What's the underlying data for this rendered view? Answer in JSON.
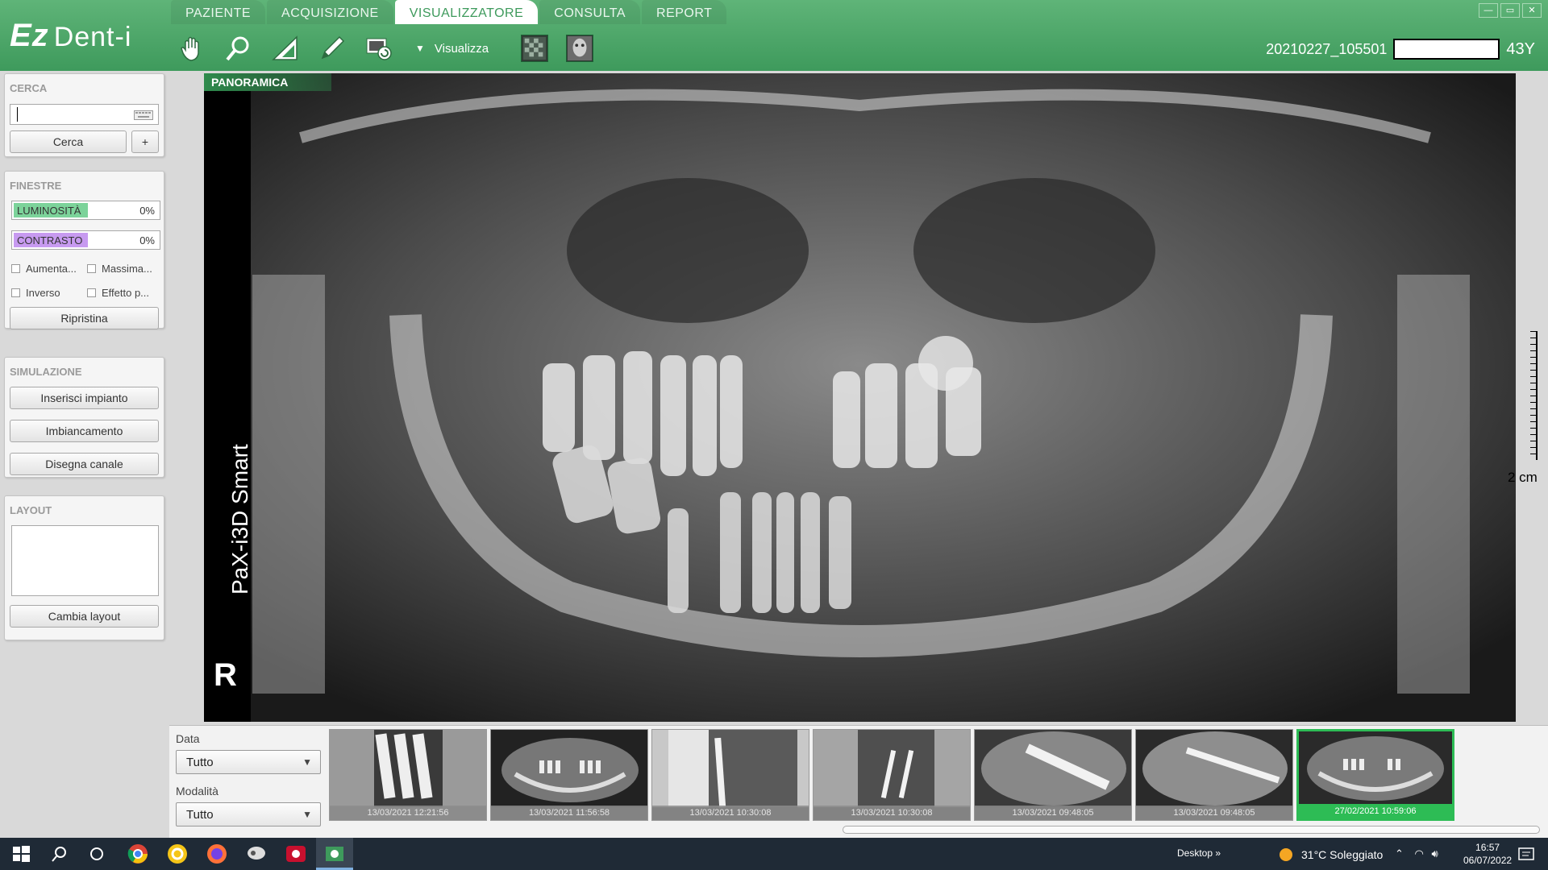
{
  "app": {
    "logo_ez": "Ez",
    "logo_dent": "Dent-i"
  },
  "tabs": [
    {
      "label": "PAZIENTE"
    },
    {
      "label": "ACQUISIZIONE"
    },
    {
      "label": "VISUALIZZATORE",
      "active": true
    },
    {
      "label": "CONSULTA"
    },
    {
      "label": "REPORT"
    }
  ],
  "toolbar": {
    "tools": [
      "hand-icon",
      "zoom-icon",
      "ruler-angle-icon",
      "pencil-icon",
      "capture-icon"
    ],
    "view_label": "Visualizza",
    "view_buttons": [
      "grid-view-icon",
      "face-view-icon"
    ]
  },
  "patient": {
    "id": "20210227_105501",
    "age": "43Y"
  },
  "window_controls": [
    "—",
    "▭",
    "✕"
  ],
  "sidebar": {
    "search": {
      "title": "CERCA",
      "value": "",
      "button": "Cerca",
      "plus": "+"
    },
    "windows": {
      "title": "FINESTRE",
      "brightness_label": "LUMINOSITÀ",
      "brightness_value": "0%",
      "brightness_color": "#7cd39a",
      "contrast_label": "CONTRASTO",
      "contrast_value": "0%",
      "contrast_color": "#c79af0",
      "checks": [
        "Aumenta...",
        "Massima...",
        "Inverso",
        "Effetto p..."
      ],
      "reset": "Ripristina"
    },
    "simulation": {
      "title": "SIMULAZIONE",
      "buttons": [
        "Inserisci impianto",
        "Imbiancamento",
        "Disegna canale"
      ]
    },
    "layout": {
      "title": "LAYOUT",
      "button": "Cambia layout"
    }
  },
  "viewer": {
    "label": "PANORAMICA",
    "device": "PaX-i3D Smart",
    "side_marker": "R",
    "scale": "2 cm"
  },
  "bottom": {
    "date_label": "Data",
    "date_value": "Tutto",
    "mode_label": "Modalità",
    "mode_value": "Tutto",
    "thumbnails": [
      {
        "date": "13/03/2021 12:21:56"
      },
      {
        "date": "13/03/2021 11:56:58"
      },
      {
        "date": "13/03/2021 10:30:08"
      },
      {
        "date": "13/03/2021 10:30:08"
      },
      {
        "date": "13/03/2021 09:48:05"
      },
      {
        "date": "13/03/2021 09:48:05"
      },
      {
        "date": "27/02/2021 10:59:06",
        "selected": true
      }
    ]
  },
  "taskbar": {
    "desktop": "Desktop",
    "weather": "31°C  Soleggiato",
    "time": "16:57",
    "date": "06/07/2022"
  }
}
